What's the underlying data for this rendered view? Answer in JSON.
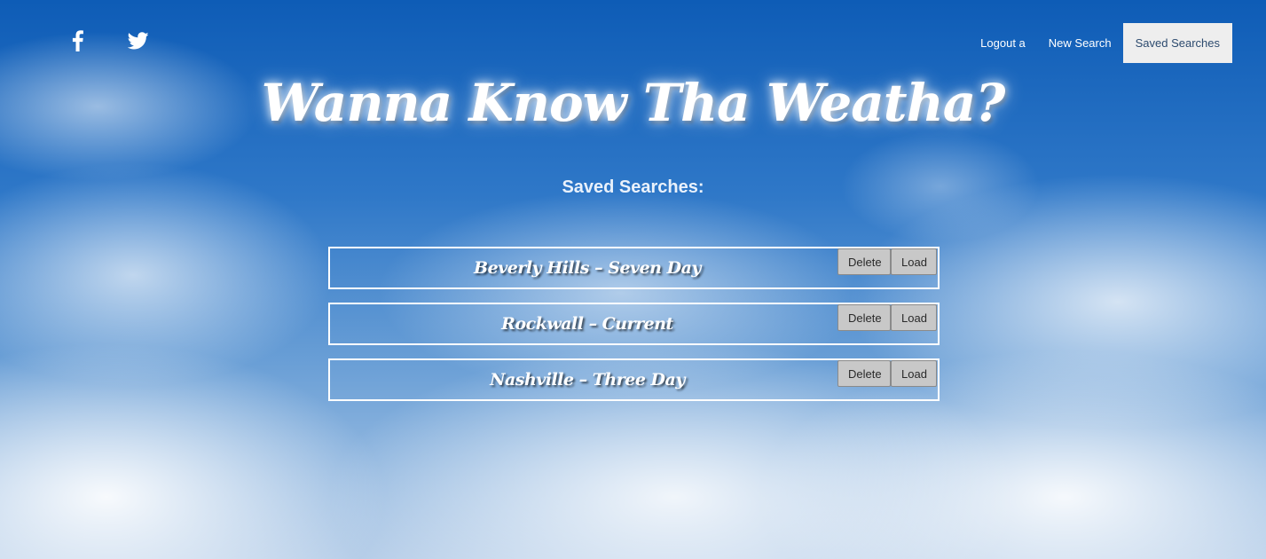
{
  "social": {
    "icons": [
      "facebook-icon",
      "twitter-icon"
    ]
  },
  "nav": {
    "logout_label": "Logout a",
    "new_search_label": "New Search",
    "saved_searches_label": "Saved Searches"
  },
  "header": {
    "title": "Wanna Know Tha Weatha?",
    "subtitle": "Saved Searches:"
  },
  "saved_searches": [
    {
      "label": "Beverly Hills – Seven Day",
      "delete_label": "Delete",
      "load_label": "Load"
    },
    {
      "label": "Rockwall – Current",
      "delete_label": "Delete",
      "load_label": "Load"
    },
    {
      "label": "Nashville – Three Day",
      "delete_label": "Delete",
      "load_label": "Load"
    }
  ],
  "colors": {
    "sky_top": "#0e5cb6",
    "sky_bottom": "#b5cde8",
    "active_nav_bg": "#eeeeee",
    "button_bg": "#c8c8c8"
  }
}
